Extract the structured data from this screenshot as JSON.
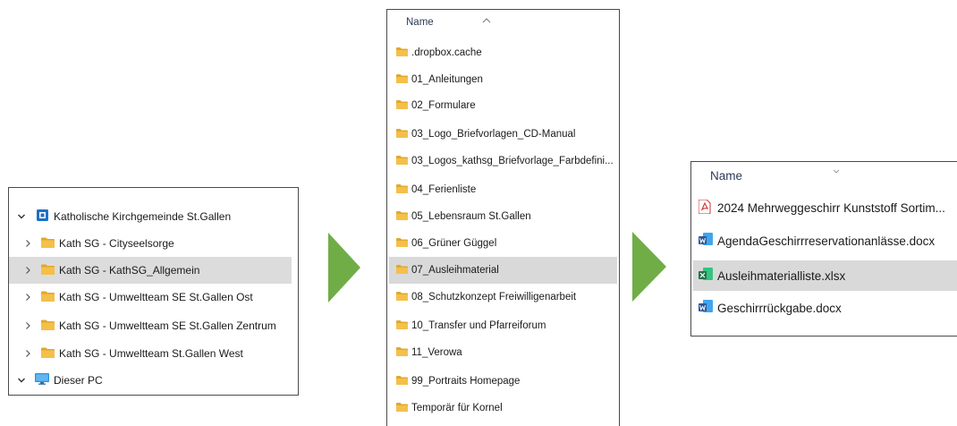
{
  "colors": {
    "folder": "#f4c04a",
    "folder_dark": "#e0a92b",
    "arrow": "#70ad47",
    "selection": "#d9d9d9",
    "header_text": "#2b3a55",
    "word_blue": "#2b5797",
    "excel_green": "#217346",
    "pdf_red": "#d32f2f"
  },
  "tree": {
    "root": {
      "label": "Katholische Kirchgemeinde St.Gallen",
      "icon": "sharepoint-site-icon",
      "expanded": true
    },
    "items": [
      {
        "label": "Kath SG - Cityseelsorge",
        "icon": "folder-icon",
        "selected": false
      },
      {
        "label": "Kath SG - KathSG_Allgemein",
        "icon": "folder-icon",
        "selected": true
      },
      {
        "label": "Kath SG - Umweltteam SE St.Gallen Ost",
        "icon": "folder-icon",
        "selected": false
      },
      {
        "label": "Kath SG - Umweltteam SE St.Gallen Zentrum",
        "icon": "folder-icon",
        "selected": false
      },
      {
        "label": "Kath SG - Umweltteam St.Gallen West",
        "icon": "folder-icon",
        "selected": false
      }
    ],
    "pc": {
      "label": "Dieser PC",
      "icon": "monitor-icon",
      "expanded": true
    }
  },
  "folders": {
    "column_header": "Name",
    "sort": "ascending",
    "items": [
      {
        "label": ".dropbox.cache",
        "selected": false
      },
      {
        "label": "01_Anleitungen",
        "selected": false
      },
      {
        "label": "02_Formulare",
        "selected": false
      },
      {
        "label": "03_Logo_Briefvorlagen_CD-Manual",
        "selected": false
      },
      {
        "label": "03_Logos_kathsg_Briefvorlage_Farbdefini...",
        "selected": false
      },
      {
        "label": "04_Ferienliste",
        "selected": false
      },
      {
        "label": "05_Lebensraum St.Gallen",
        "selected": false
      },
      {
        "label": "06_Grüner Güggel",
        "selected": false
      },
      {
        "label": "07_Ausleihmaterial",
        "selected": true
      },
      {
        "label": "08_Schutzkonzept Freiwilligenarbeit",
        "selected": false
      },
      {
        "label": "10_Transfer und Pfarreiforum",
        "selected": false
      },
      {
        "label": "11_Verowa",
        "selected": false
      },
      {
        "label": "99_Portraits Homepage",
        "selected": false
      },
      {
        "label": "Temporär für Kornel",
        "selected": false
      }
    ]
  },
  "files": {
    "column_header": "Name",
    "items": [
      {
        "label": "2024 Mehrweggeschirr Kunststoff Sortim...",
        "icon": "pdf-file-icon",
        "selected": false
      },
      {
        "label": "AgendaGeschirrreservationanlässe.docx",
        "icon": "word-file-icon",
        "selected": false
      },
      {
        "label": "Ausleihmaterialliste.xlsx",
        "icon": "excel-file-icon",
        "selected": true
      },
      {
        "label": "Geschirrrückgabe.docx",
        "icon": "word-file-icon",
        "selected": false
      }
    ]
  }
}
